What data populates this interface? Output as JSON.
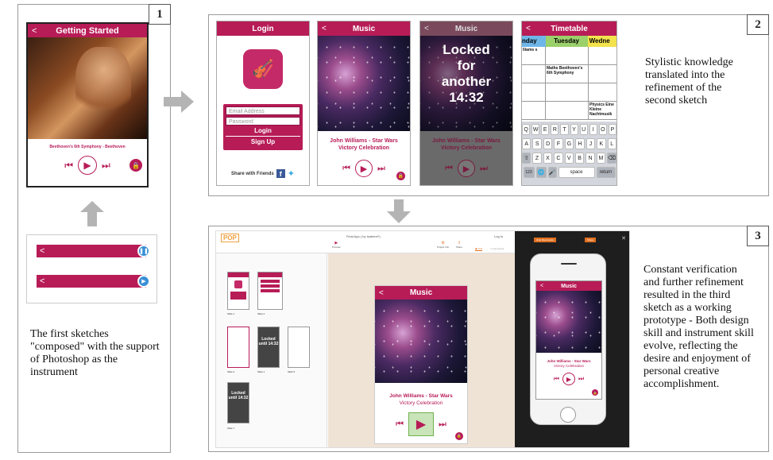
{
  "panels": {
    "p1": {
      "number": "1",
      "caption": "The first sketches \"composed\" with the support of Photoshop as the instrument"
    },
    "p2": {
      "number": "2",
      "caption": "Stylistic knowledge translated into the refinement of the second sketch"
    },
    "p3": {
      "number": "3",
      "caption": "Constant verification and further refinement resulted in the third sketch as a working prototype - Both design skill and instrument skill evolve, reflecting the desire and enjoyment of personal creative accomplishment."
    }
  },
  "sketch1": {
    "title": "Getting Started",
    "song": "Beethoven's 6th Symphony - Beethoven"
  },
  "login": {
    "title": "Login",
    "email_placeholder": "Email Address",
    "password_placeholder": "Password",
    "login_btn": "Login",
    "signup_btn": "Sign Up",
    "share": "Share with Friends"
  },
  "music": {
    "title": "Music",
    "song_line1": "John Williams - Star Wars",
    "song_line2": "Victory Celebration"
  },
  "locked": {
    "title": "Music",
    "text_l1": "Locked",
    "text_l2": "for",
    "text_l3": "another",
    "text_l4": "14:32"
  },
  "timetable": {
    "title": "Timetable",
    "days": [
      "nday",
      "Tuesday",
      "Wedne"
    ],
    "cell_a": "lliams s",
    "cell_b": "Maths Beethoven's 6th Symphony",
    "cell_c": "Physics Eine Kleine Nachtmusik",
    "row1": [
      "Q",
      "W",
      "E",
      "R",
      "T",
      "Y",
      "U",
      "I",
      "O",
      "P"
    ],
    "row2": [
      "A",
      "S",
      "D",
      "F",
      "G",
      "H",
      "J",
      "K",
      "L"
    ],
    "row3": [
      "Z",
      "X",
      "C",
      "V",
      "B",
      "N",
      "M"
    ],
    "space": "space",
    "return": "return",
    "num": "123"
  },
  "proto": {
    "logo": "POP",
    "app_title": "Final App ( by Isaberel*)",
    "login": "Log In",
    "toolbar": [
      "Preview",
      "Project Info",
      "Share",
      "Link",
      "Comments"
    ],
    "right_btn1": "Hide Bookmarks",
    "right_btn2": "Share",
    "thumbs": [
      "Slide 1",
      "Slide 2",
      "Slide 3",
      "Slide 4",
      "Slide 5",
      "Slide 6",
      "Slide 7"
    ],
    "locked_thumb": "Locked until 14:32",
    "phone_title": "Music",
    "colors": {
      "accent": "#b71c57",
      "canvas": "#efe3d6",
      "dark": "#1e1e1e"
    }
  }
}
